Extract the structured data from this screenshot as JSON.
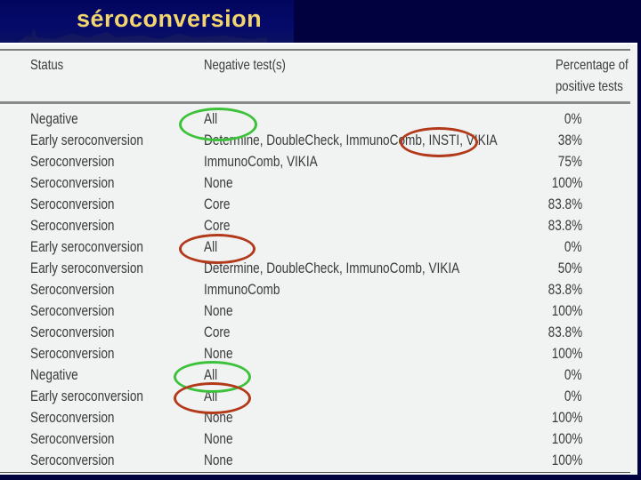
{
  "slide": {
    "title": "séroconversion",
    "title_color": "#f2d56c",
    "background_color": "#01013f"
  },
  "table": {
    "headers": {
      "status": "Status",
      "negative_tests": "Negative test(s)",
      "percentage_line1": "Percentage of",
      "percentage_line2": "positive tests"
    },
    "rows": [
      {
        "status": "Negative",
        "negative_tests": "All",
        "percentage": "0%"
      },
      {
        "status": "Early seroconversion",
        "negative_tests": "Determine, DoubleCheck, ImmunoComb, INSTI, VIKIA",
        "percentage": "38%"
      },
      {
        "status": "Seroconversion",
        "negative_tests": "ImmunoComb, VIKIA",
        "percentage": "75%"
      },
      {
        "status": "Seroconversion",
        "negative_tests": "None",
        "percentage": "100%"
      },
      {
        "status": "Seroconversion",
        "negative_tests": "Core",
        "percentage": "83.8%"
      },
      {
        "status": "Seroconversion",
        "negative_tests": "Core",
        "percentage": "83.8%"
      },
      {
        "status": "Early seroconversion",
        "negative_tests": "All",
        "percentage": "0%"
      },
      {
        "status": "Early seroconversion",
        "negative_tests": "Determine, DoubleCheck, ImmunoComb, VIKIA",
        "percentage": "50%"
      },
      {
        "status": "Seroconversion",
        "negative_tests": "ImmunoComb",
        "percentage": "83.8%"
      },
      {
        "status": "Seroconversion",
        "negative_tests": "None",
        "percentage": "100%"
      },
      {
        "status": "Seroconversion",
        "negative_tests": "Core",
        "percentage": "83.8%"
      },
      {
        "status": "Seroconversion",
        "negative_tests": "None",
        "percentage": "100%"
      },
      {
        "status": "Negative",
        "negative_tests": "All",
        "percentage": "0%"
      },
      {
        "status": "Early seroconversion",
        "negative_tests": "All",
        "percentage": "0%"
      },
      {
        "status": "Seroconversion",
        "negative_tests": "None",
        "percentage": "100%"
      },
      {
        "status": "Seroconversion",
        "negative_tests": "None",
        "percentage": "100%"
      },
      {
        "status": "Seroconversion",
        "negative_tests": "None",
        "percentage": "100%"
      }
    ]
  },
  "annotations": [
    {
      "color": "green",
      "hex": "#3cc23a",
      "target": "row 1 'All'"
    },
    {
      "color": "red",
      "hex": "#b23a1a",
      "target": "row 2 'INSTI'"
    },
    {
      "color": "red",
      "hex": "#b23a1a",
      "target": "row 7 'All'"
    },
    {
      "color": "green",
      "hex": "#3cc23a",
      "target": "row 13 'All'"
    },
    {
      "color": "red",
      "hex": "#b23a1a",
      "target": "row 14 'All'"
    }
  ]
}
